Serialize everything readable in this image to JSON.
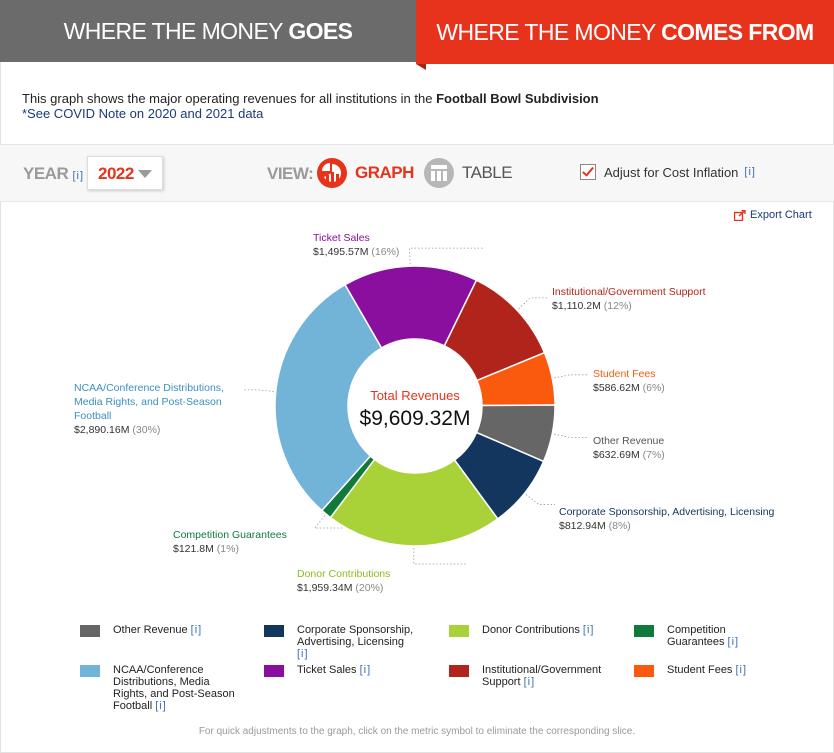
{
  "tabs": {
    "goes_prefix": "WHERE THE MONEY ",
    "goes_bold": "GOES",
    "comes_prefix": "WHERE THE MONEY ",
    "comes_bold": "COMES FROM"
  },
  "intro": {
    "text": "This graph shows the major operating revenues for all institutions in the ",
    "bold": "Football Bowl Subdivision",
    "covid": "*See COVID Note on 2020 and 2021 data"
  },
  "controls": {
    "year_label": "YEAR",
    "info": "[i]",
    "year_value": "2022",
    "view_label": "VIEW:",
    "graph_label": "GRAPH",
    "table_label": "TABLE",
    "adjust_label": "Adjust for Cost Inflation",
    "adjust_checked": true
  },
  "export_label": "Export Chart",
  "colors": {
    "accent": "#e8331c",
    "tab_inactive": "#6b6b6b",
    "link": "#1a3a7a"
  },
  "chart_data": {
    "type": "pie",
    "center_title": "Total Revenues",
    "center_value": "$9,609.32M",
    "slices": [
      {
        "label": "Ticket Sales",
        "value_text": "$1,495.57M",
        "pct_text": "(16%)",
        "value": 1495.57,
        "color": "#8a0f9e"
      },
      {
        "label": "Institutional/Government Support",
        "value_text": "$1,110.2M",
        "pct_text": "(12%)",
        "value": 1110.2,
        "color": "#b0241c"
      },
      {
        "label": "Student Fees",
        "value_text": "$586.62M",
        "pct_text": "(6%)",
        "value": 586.62,
        "color": "#fa5a0e"
      },
      {
        "label": "Other Revenue",
        "value_text": "$632.69M",
        "pct_text": "(7%)",
        "value": 632.69,
        "color": "#666666"
      },
      {
        "label": "Corporate Sponsorship, Advertising, Licensing",
        "value_text": "$812.94M",
        "pct_text": "(8%)",
        "value": 812.94,
        "color": "#12365e"
      },
      {
        "label": "Donor Contributions",
        "value_text": "$1,959.34M",
        "pct_text": "(20%)",
        "value": 1959.34,
        "color": "#a8d237"
      },
      {
        "label": "Competition Guarantees",
        "value_text": "$121.8M",
        "pct_text": "(1%)",
        "value": 121.8,
        "color": "#0f7a3a"
      },
      {
        "label": "NCAA/Conference Distributions, Media Rights, and Post-Season Football",
        "value_text": "$2,890.16M",
        "pct_text": "(30%)",
        "value": 2890.16,
        "color": "#72b3d8"
      }
    ]
  },
  "legend": [
    {
      "label": "Other Revenue",
      "color": "#666666",
      "info": "[i]"
    },
    {
      "label": "Corporate Sponsorship, Advertising, Licensing",
      "color": "#12365e",
      "info": "[i]"
    },
    {
      "label": "Donor Contributions",
      "color": "#a8d237",
      "info": "[i]"
    },
    {
      "label": "Competition Guarantees",
      "color": "#0f7a3a",
      "info": "[i]"
    },
    {
      "label": "NCAA/Conference Distributions, Media Rights, and Post-Season Football",
      "color": "#72b3d8",
      "info": "[i]"
    },
    {
      "label": "Ticket Sales",
      "color": "#8a0f9e",
      "info": "[i]"
    },
    {
      "label": "Institutional/Government Support",
      "color": "#b0241c",
      "info": "[i]"
    },
    {
      "label": "Student Fees",
      "color": "#fa5a0e",
      "info": "[i]"
    }
  ],
  "footnote": "For quick adjustments to the graph, click on the metric symbol to eliminate the corresponding slice."
}
